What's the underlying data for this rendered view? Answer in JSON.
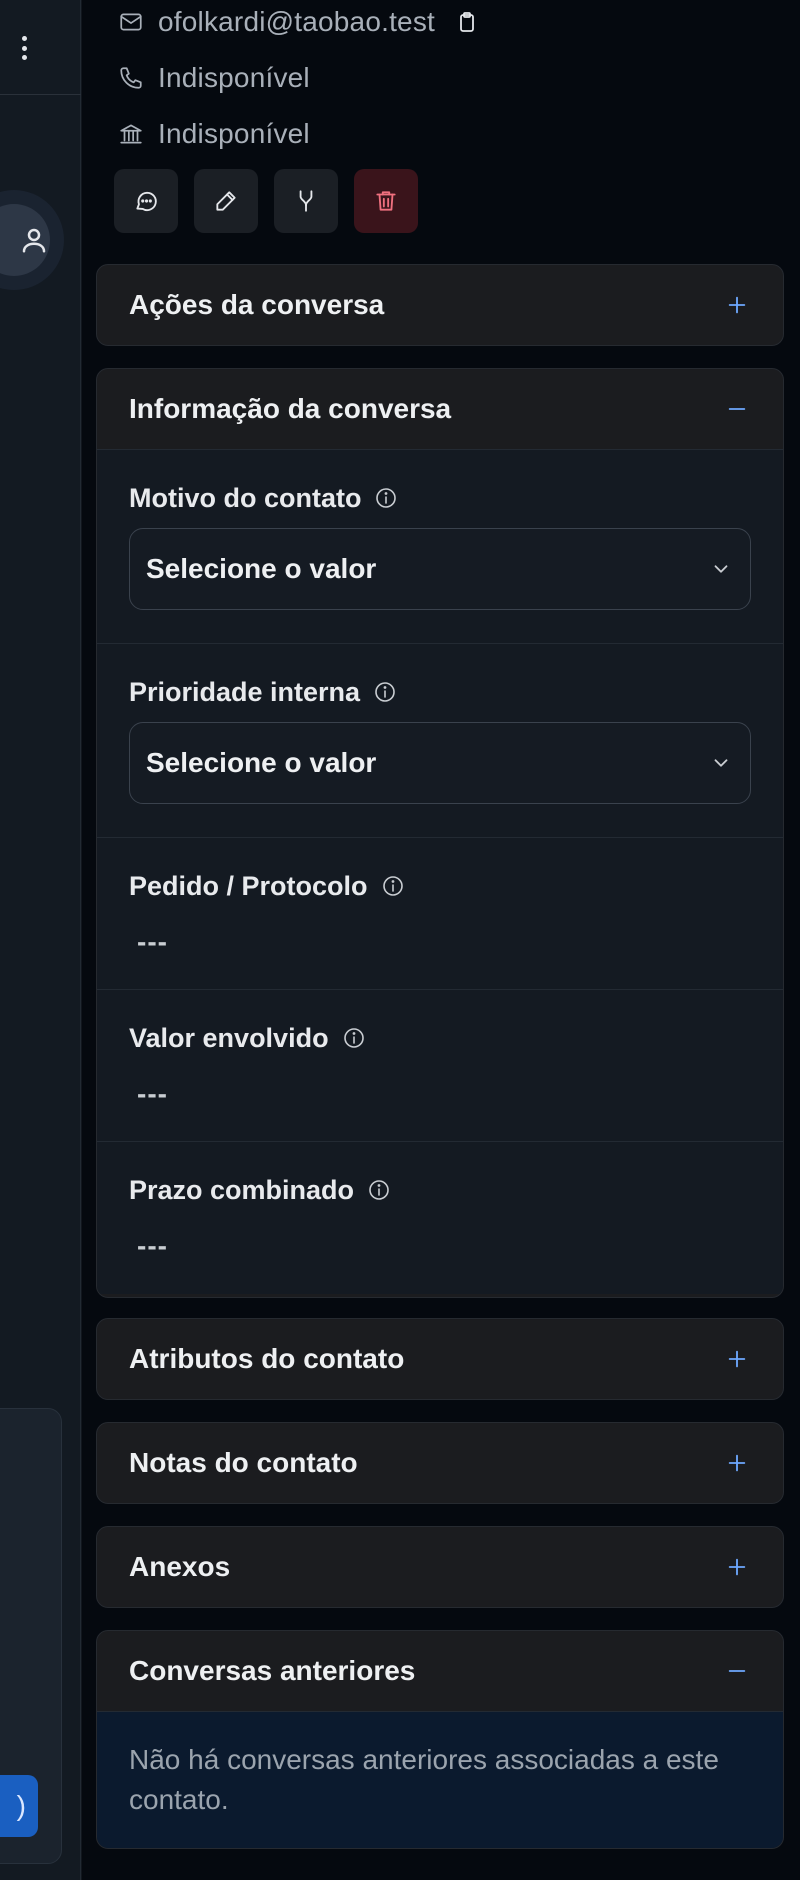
{
  "left": {
    "button_label": ")"
  },
  "contact": {
    "email": "ofolkardi@taobao.test",
    "phone": "Indisponível",
    "company": "Indisponível"
  },
  "actions": {
    "icons": [
      "chat-icon",
      "pencil-icon",
      "merge-icon",
      "trash-icon"
    ]
  },
  "sections": {
    "conversation_actions": {
      "title": "Ações da conversa",
      "state": "collapsed"
    },
    "conversation_info": {
      "title": "Informação da conversa",
      "state": "expanded",
      "fields": [
        {
          "label": "Motivo do contato",
          "type": "select",
          "value": "Selecione o valor"
        },
        {
          "label": "Prioridade interna",
          "type": "select",
          "value": "Selecione o valor"
        },
        {
          "label": "Pedido / Protocolo",
          "type": "text",
          "value": "---"
        },
        {
          "label": "Valor envolvido",
          "type": "text",
          "value": "---"
        },
        {
          "label": "Prazo combinado",
          "type": "text",
          "value": "---"
        }
      ]
    },
    "contact_attributes": {
      "title": "Atributos do contato",
      "state": "collapsed"
    },
    "contact_notes": {
      "title": "Notas do contato",
      "state": "collapsed"
    },
    "attachments": {
      "title": "Anexos",
      "state": "collapsed"
    },
    "previous_conversations": {
      "title": "Conversas anteriores",
      "state": "expanded",
      "empty_text": "Não há conversas anteriores associadas a este contato."
    }
  },
  "colors": {
    "accent": "#6ea8fe",
    "danger": "#f0707f",
    "panel_bg": "#05090f",
    "section_bg": "#1b1c1f"
  }
}
